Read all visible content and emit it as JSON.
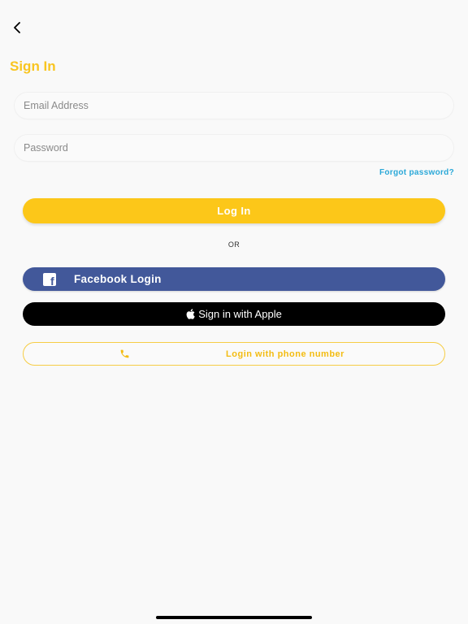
{
  "header": {
    "title": "Sign In"
  },
  "form": {
    "email_placeholder": "Email Address",
    "email_value": "",
    "password_placeholder": "Password",
    "password_value": "",
    "forgot_label": "Forgot password?"
  },
  "actions": {
    "login_label": "Log In",
    "or_label": "OR",
    "facebook_label": "Facebook Login",
    "facebook_icon_glyph": "f",
    "apple_label": "Sign in with Apple",
    "phone_label": "Login with phone number"
  },
  "icons": {
    "back": "chevron-left-icon",
    "facebook": "facebook-icon",
    "apple": "apple-icon",
    "phone": "phone-icon"
  },
  "colors": {
    "accent": "#fcc719",
    "title": "#f9c520",
    "link": "#2aa8d8",
    "facebook": "#42589a",
    "apple": "#000000"
  }
}
